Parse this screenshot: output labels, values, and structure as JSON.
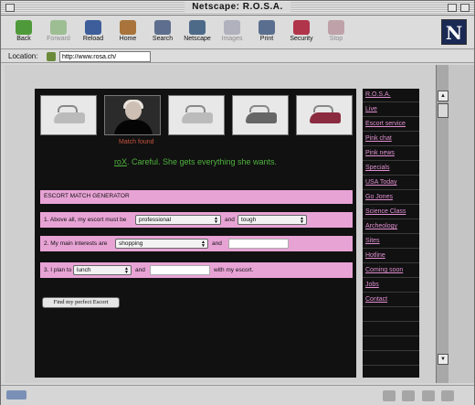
{
  "window": {
    "title": "Netscape: R.O.S.A."
  },
  "toolbar": {
    "buttons": [
      {
        "label": "Back",
        "disabled": false
      },
      {
        "label": "Forward",
        "disabled": true
      },
      {
        "label": "Reload",
        "disabled": false
      },
      {
        "label": "Home",
        "disabled": false
      },
      {
        "label": "Search",
        "disabled": false
      },
      {
        "label": "Netscape",
        "disabled": false
      },
      {
        "label": "Images",
        "disabled": true
      },
      {
        "label": "Print",
        "disabled": false
      },
      {
        "label": "Security",
        "disabled": false
      },
      {
        "label": "Stop",
        "disabled": true
      }
    ],
    "logo": "N"
  },
  "location": {
    "label": "Location:",
    "url": "http://www.rosa.ch/"
  },
  "page": {
    "caption": "Match found",
    "warning_link": "roX",
    "warning_text": ". Careful. She gets everything she wants.",
    "generator_title": "ESCORT MATCH GENERATOR",
    "row1": {
      "prefix": "1. Above all, my escort must be",
      "select1": "professional",
      "mid": "and",
      "select2": "tough"
    },
    "row2": {
      "prefix": "2. My main interests are",
      "select1": "shopping",
      "mid": "and",
      "field": ""
    },
    "row3": {
      "prefix": "3. I plan to",
      "select1": "lunch",
      "mid": "and",
      "field": "",
      "suffix": "with my escort."
    },
    "button": "Find my perfect Escort"
  },
  "nav": {
    "items": [
      "R.O.S.A.",
      "Live",
      "Escort service",
      "Pink chat",
      "Pink news",
      "Specials",
      "USA Today",
      "Go Jones",
      "Science Class",
      "Archeology",
      "Sites",
      "Hotline",
      "Coming soon",
      "Jobs",
      "Contact"
    ]
  },
  "colors": {
    "nav_link": "#e08fd0",
    "form_bar": "#e8a3d5",
    "warning": "#4fb13e",
    "caption": "#c6543f",
    "page_bg": "#111111"
  }
}
